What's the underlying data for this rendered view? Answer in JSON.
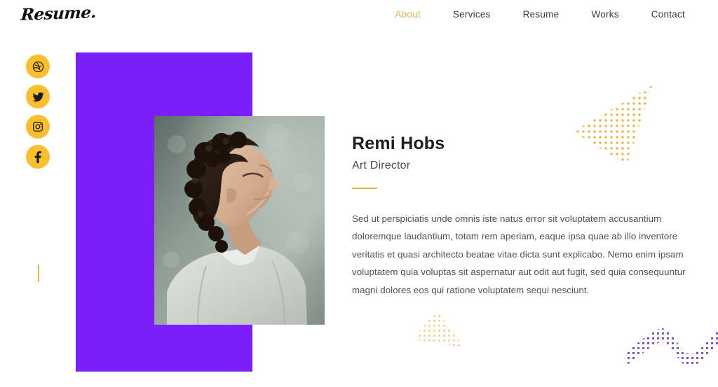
{
  "header": {
    "logo": "Resume.",
    "nav": [
      {
        "label": "About",
        "active": true
      },
      {
        "label": "Services",
        "active": false
      },
      {
        "label": "Resume",
        "active": false
      },
      {
        "label": "Works",
        "active": false
      },
      {
        "label": "Contact",
        "active": false
      }
    ]
  },
  "social": {
    "items": [
      {
        "icon": "dribbble-icon",
        "label": "Dribbble"
      },
      {
        "icon": "twitter-icon",
        "label": "Twitter"
      },
      {
        "icon": "instagram-icon",
        "label": "Instagram"
      },
      {
        "icon": "facebook-icon",
        "label": "Facebook"
      }
    ]
  },
  "hero": {
    "photo_alt": "Man with curly dark hair in a light grey hoodie looking upward"
  },
  "bio": {
    "name": "Remi Hobs",
    "role": "Art Director",
    "text": "Sed ut perspiciatis unde omnis iste natus error sit voluptatem accusantium doloremque laudantium, totam rem aperiam, eaque ipsa quae ab illo inventore veritatis et quasi architecto beatae vitae dicta sunt explicabo. Nemo enim ipsam voluptatem quia voluptas sit aspernatur aut odit aut fugit, sed quia consequuntur magni dolores eos qui ratione voluptatem sequi nesciunt."
  },
  "decor": {
    "triangle_top": "dotted-triangle-gold",
    "triangle_bottom": "dotted-triangle-gold-faded",
    "wave": "dotted-wave-purple"
  },
  "colors": {
    "accent_gold": "#e7b44a",
    "social_gold": "#fbbe2c",
    "purple_block": "#7a1ffa",
    "decor_purple": "#7a52d6",
    "nav_text": "#3b3b3b",
    "heading": "#1d1d1d",
    "body_text": "#4d5257",
    "background": "#ffffff"
  }
}
